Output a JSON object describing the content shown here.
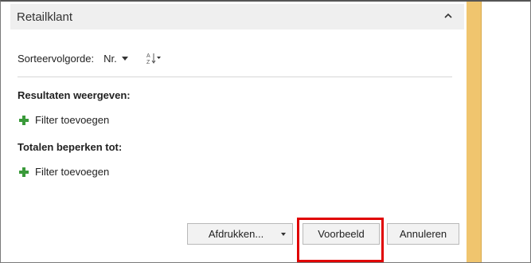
{
  "section": {
    "title": "Retailklant"
  },
  "sort": {
    "label": "Sorteervolgorde:",
    "value": "Nr."
  },
  "results": {
    "heading": "Resultaten weergeven:",
    "add_filter": "Filter toevoegen"
  },
  "totals": {
    "heading": "Totalen beperken tot:",
    "add_filter": "Filter toevoegen"
  },
  "buttons": {
    "print": "Afdrukken...",
    "preview": "Voorbeeld",
    "cancel": "Annuleren"
  },
  "colors": {
    "highlight": "#e00000",
    "plus": "#3a9a3a",
    "strip": "#f0c56e"
  },
  "icons": [
    "chevron-up-icon",
    "caret-down-icon",
    "sort-az-icon",
    "plus-icon"
  ]
}
